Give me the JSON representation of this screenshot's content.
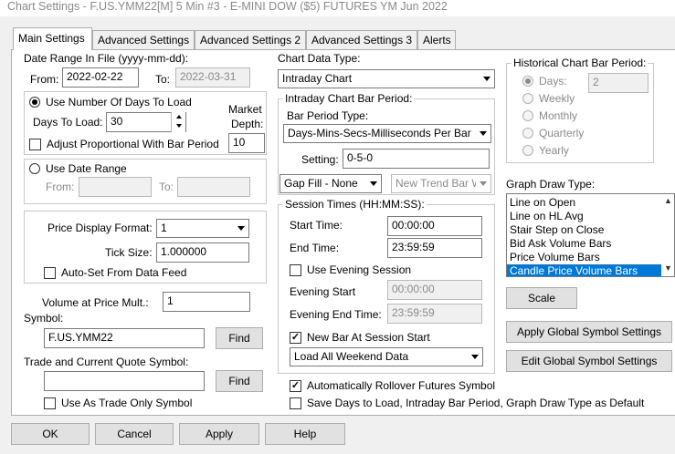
{
  "window": {
    "title": "Chart Settings - F.US.YMM22[M]  5 Min   #3 - E-MINI DOW ($5) FUTURES YM Jun 2022"
  },
  "tabs": [
    "Main Settings",
    "Advanced Settings",
    "Advanced Settings 2",
    "Advanced Settings 3",
    "Alerts"
  ],
  "date_range": {
    "label": "Date Range In File (yyyy-mm-dd):",
    "from_label": "From:",
    "from_value": "2022-02-22",
    "to_label": "To:",
    "to_value": "2022-03-31"
  },
  "days_group": {
    "use_days_label": "Use Number Of Days To Load",
    "days_to_load_label": "Days To Load:",
    "days_to_load_value": "30",
    "market_depth_label": "Market Depth:",
    "market_depth_value": "10",
    "adjust_label": "Adjust Proportional With Bar Period"
  },
  "date_range_group": {
    "use_date_range_label": "Use Date Range",
    "from_label": "From:",
    "to_label": "To:"
  },
  "price_group": {
    "format_label": "Price Display Format:",
    "format_value": "1",
    "tick_label": "Tick Size:",
    "tick_value": "1.000000",
    "autoset_label": "Auto-Set From Data Feed"
  },
  "volume": {
    "label": "Volume at Price Mult.:",
    "value": "1"
  },
  "symbol": {
    "label": "Symbol:",
    "value": "F.US.YMM22",
    "find": "Find"
  },
  "trade_symbol": {
    "label": "Trade and Current Quote Symbol:",
    "value": "",
    "find": "Find",
    "trade_only_label": "Use As Trade Only Symbol"
  },
  "chart_type": {
    "label": "Chart Data Type:",
    "value": "Intraday Chart"
  },
  "intraday_period": {
    "label": "Intraday Chart Bar Period:",
    "type_label": "Bar Period Type:",
    "type_value": "Days-Mins-Secs-Milliseconds Per Bar",
    "setting_label": "Setting:",
    "setting_value": "0-5-0",
    "gap_fill": "Gap Fill - None",
    "new_trend": "New Trend Bar W"
  },
  "session": {
    "label": "Session Times (HH:MM:SS):",
    "start_label": "Start Time:",
    "start_value": "00:00:00",
    "end_label": "End Time:",
    "end_value": "23:59:59",
    "evening_label": "Use Evening Session",
    "evening_start_label": "Evening Start",
    "evening_start_value": "00:00:00",
    "evening_end_label": "Evening End Time:",
    "evening_end_value": "23:59:59",
    "new_bar_label": "New Bar At Session Start",
    "weekend_value": "Load All Weekend Data"
  },
  "rollover_label": "Automatically Rollover Futures Symbol",
  "save_default_label": "Save Days to Load, Intraday Bar Period, Graph Draw Type as Default",
  "historical": {
    "label": "Historical Chart Bar Period:",
    "days": "Days:",
    "days_value": "2",
    "weekly": "Weekly",
    "monthly": "Monthly",
    "quarterly": "Quarterly",
    "yearly": "Yearly"
  },
  "graph_draw": {
    "label": "Graph Draw Type:",
    "items": [
      "Line on Open",
      "Line on HL Avg",
      "Stair Step on Close",
      "Bid Ask Volume Bars",
      "Price Volume Bars",
      "Candle Price Volume Bars"
    ],
    "selected": "Candle Price Volume Bars"
  },
  "buttons": {
    "scale": "Scale",
    "apply_global": "Apply Global Symbol Settings",
    "edit_global": "Edit Global Symbol Settings",
    "ok": "OK",
    "cancel": "Cancel",
    "apply": "Apply",
    "help": "Help"
  },
  "colors": {
    "selection": "#0078d7",
    "disabled_text": "#8a8a8a",
    "face": "#f0f0f0"
  }
}
